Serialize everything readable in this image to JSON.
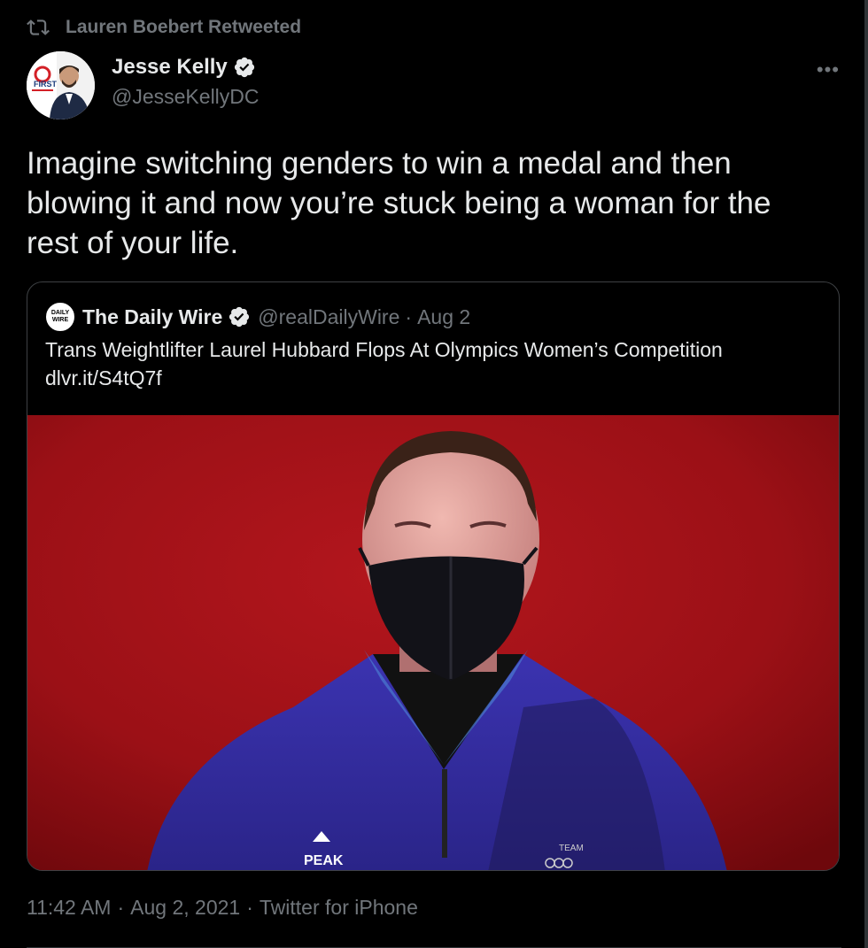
{
  "retweet": {
    "label": "Lauren Boebert Retweeted"
  },
  "author": {
    "name": "Jesse Kelly",
    "handle": "@JesseKellyDC",
    "avatar_badge": "FIRST"
  },
  "more_label": "•••",
  "tweet": {
    "text": "Imagine switching genders to win a medal and then blowing it and now you’re stuck being a woman for the rest of your life."
  },
  "quote": {
    "logo_top": "DAILY",
    "logo_bottom": "WIRE",
    "name": "The Daily Wire",
    "handle": "@realDailyWire",
    "dot": "·",
    "date": "Aug 2",
    "text_line1": "Trans Weightlifter Laurel Hubbard Flops At Olympics Women’s Competition",
    "text_line2": "dlvr.it/S4tQ7f",
    "image_logo_text": "PEAK",
    "image_team_text": "TEAM"
  },
  "meta": {
    "time": "11:42 AM",
    "date": "Aug 2, 2021",
    "client": "Twitter for iPhone",
    "sep": "·"
  },
  "colors": {
    "background": "#000000",
    "text": "#e7e9ea",
    "muted": "#71767b",
    "verified": "#e7e9ea",
    "image_red": "#a8121a",
    "jacket_blue": "#3b35a8"
  },
  "icons": {
    "retweet": "retweet-icon",
    "verified": "verified-badge-icon",
    "more": "more-icon"
  }
}
